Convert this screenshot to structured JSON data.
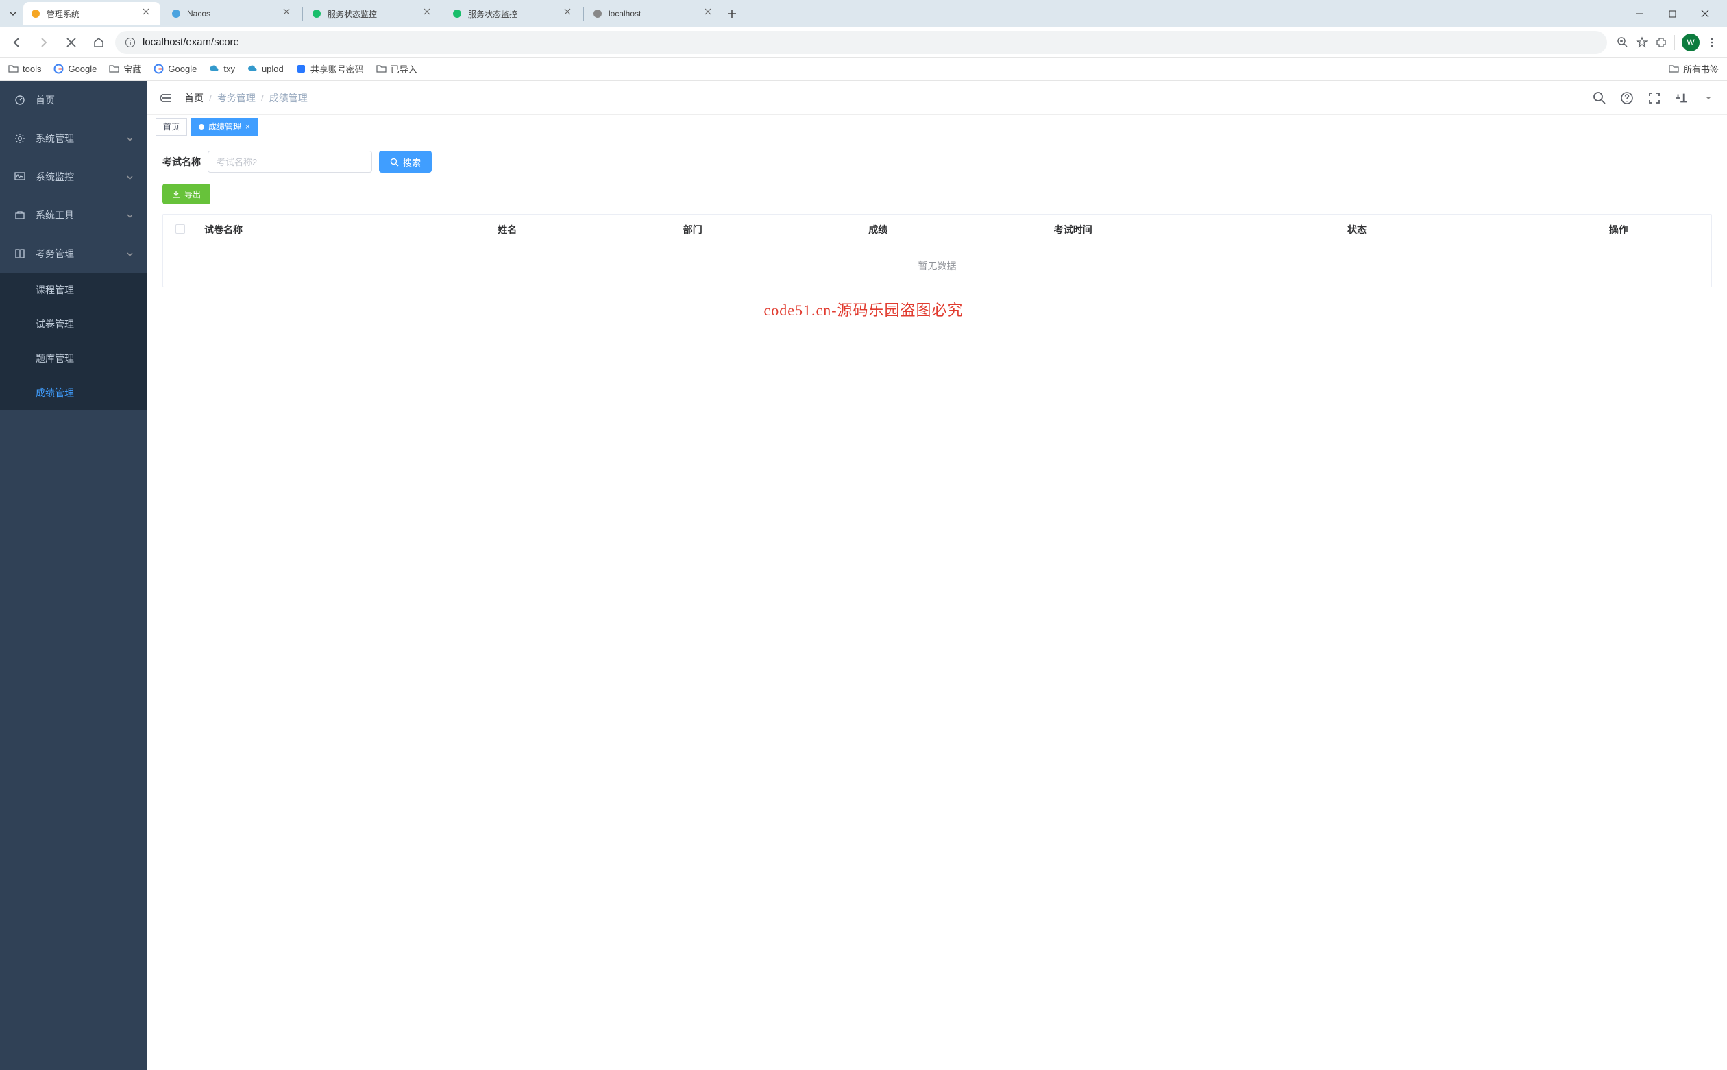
{
  "browser": {
    "tabs": [
      {
        "title": "管理系统",
        "icon_color": "#f5a623",
        "active": true
      },
      {
        "title": "Nacos",
        "icon_color": "#4aa3df",
        "active": false
      },
      {
        "title": "服务状态监控",
        "icon_color": "#19be6b",
        "active": false
      },
      {
        "title": "服务状态监控",
        "icon_color": "#19be6b",
        "active": false
      },
      {
        "title": "localhost",
        "icon_color": "#888",
        "active": false
      }
    ],
    "url": "localhost/exam/score",
    "avatar_letter": "W",
    "bookmarks": {
      "items": [
        "tools",
        "Google",
        "宝藏",
        "Google",
        "txy",
        "uplod",
        "共享账号密码",
        "已导入"
      ],
      "all_label": "所有书签"
    }
  },
  "sidebar": {
    "items": [
      {
        "label": "首页",
        "icon": "dashboard",
        "type": "link"
      },
      {
        "label": "系统管理",
        "icon": "gear",
        "type": "group",
        "expanded": false
      },
      {
        "label": "系统监控",
        "icon": "monitor",
        "type": "group",
        "expanded": false
      },
      {
        "label": "系统工具",
        "icon": "briefcase",
        "type": "group",
        "expanded": false
      },
      {
        "label": "考务管理",
        "icon": "book",
        "type": "group",
        "expanded": true,
        "children": [
          {
            "label": "课程管理",
            "active": false
          },
          {
            "label": "试卷管理",
            "active": false
          },
          {
            "label": "题库管理",
            "active": false
          },
          {
            "label": "成绩管理",
            "active": true
          }
        ]
      }
    ]
  },
  "topbar": {
    "breadcrumb": [
      "首页",
      "考务管理",
      "成绩管理"
    ]
  },
  "view_tabs": [
    {
      "label": "首页",
      "active": false,
      "closable": false
    },
    {
      "label": "成绩管理",
      "active": true,
      "closable": true
    }
  ],
  "content": {
    "search": {
      "label": "考试名称",
      "placeholder": "考试名称2",
      "button": "搜索"
    },
    "export_button": "导出",
    "table": {
      "columns": [
        "试卷名称",
        "姓名",
        "部门",
        "成绩",
        "考试时间",
        "状态",
        "操作"
      ],
      "empty_text": "暂无数据"
    }
  },
  "watermark": "code51.cn-源码乐园盗图必究"
}
